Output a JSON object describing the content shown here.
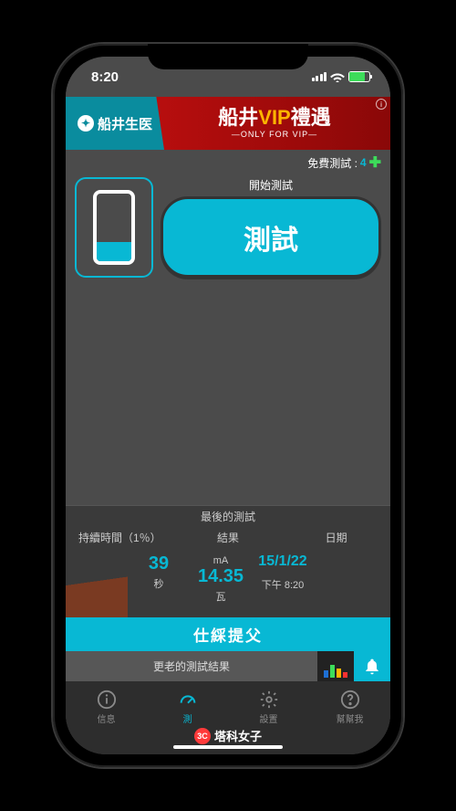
{
  "status": {
    "time": "8:20"
  },
  "ad": {
    "brand": "船井生医",
    "title_a": "船井",
    "title_b": "VIP",
    "title_c": "禮遇",
    "sub": "—ONLY FOR VIP—"
  },
  "free_test": {
    "label": "免費測試 : ",
    "count": "4"
  },
  "test": {
    "start_label": "開始測試",
    "button": "測試"
  },
  "results": {
    "title": "最後的測試",
    "col1_header": "持續時間（1％）",
    "col2_header": "結果",
    "col3_header": "日期",
    "duration": "39",
    "duration_unit": "秒",
    "ma_label": "mA",
    "ma_value": "14.35",
    "watt_label": "瓦",
    "date": "15/1/22",
    "time": "下午 8:20",
    "submit": "仕綵提父",
    "older": "更老的測試結果"
  },
  "tabs": {
    "info": "信息",
    "test": "測",
    "settings": "設置",
    "help": "幫幫我"
  },
  "brand": "塔科女子"
}
